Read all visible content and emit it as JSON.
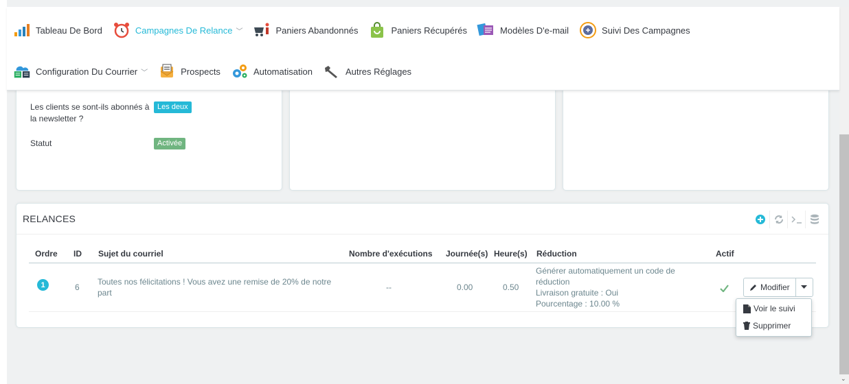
{
  "nav": {
    "row1": [
      {
        "label": "Tableau De Bord",
        "icon": "bar-chart-icon",
        "active": false,
        "chevron": false
      },
      {
        "label": "Campagnes De Relance",
        "icon": "alarm-clock-icon",
        "active": true,
        "chevron": true
      },
      {
        "label": "Paniers Abandonnés",
        "icon": "cart-person-icon",
        "active": false,
        "chevron": false
      },
      {
        "label": "Paniers Récupérés",
        "icon": "shopping-bag-icon",
        "active": false,
        "chevron": false
      },
      {
        "label": "Modèles D'e-mail",
        "icon": "email-template-icon",
        "active": false,
        "chevron": false
      },
      {
        "label": "Suivi Des Campagnes",
        "icon": "tracking-icon",
        "active": false,
        "chevron": false
      }
    ],
    "row2": [
      {
        "label": "Configuration Du Courrier",
        "icon": "mail-server-icon",
        "active": false,
        "chevron": true
      },
      {
        "label": "Prospects",
        "icon": "envelope-icon",
        "active": false,
        "chevron": false
      },
      {
        "label": "Automatisation",
        "icon": "gears-icon",
        "active": false,
        "chevron": false
      },
      {
        "label": "Autres Réglages",
        "icon": "wrench-icon",
        "active": false,
        "chevron": false
      }
    ]
  },
  "info_card": {
    "newsletter_label": "Les clients se sont-ils abonnés à la newsletter ?",
    "newsletter_value": "Les deux",
    "status_label": "Statut",
    "status_value": "Activée"
  },
  "panel": {
    "title": "RELANCES",
    "actions": [
      "add-icon",
      "refresh-icon",
      "terminal-icon",
      "database-icon"
    ]
  },
  "table": {
    "headers": {
      "order": "Ordre",
      "id": "ID",
      "subject": "Sujet du courriel",
      "executions": "Nombre d'exécutions",
      "days": "Journée(s)",
      "hours": "Heure(s)",
      "reduction": "Réduction",
      "active": "Actif"
    },
    "rows": [
      {
        "order": "1",
        "id": "6",
        "subject": "Toutes nos félicitations ! Vous avez une remise de 20% de notre part",
        "executions": "--",
        "days": "0.00",
        "hours": "0.50",
        "reduction": [
          "Générer automatiquement un code de réduction",
          "Livraison gratuite : Oui",
          "Pourcentage : 10.00 %"
        ],
        "active": true,
        "edit_label": "Modifier"
      }
    ]
  },
  "dropdown": {
    "view_label": "Voir le suivi",
    "delete_label": "Supprimer"
  },
  "colors": {
    "accent": "#25b9d7",
    "success": "#70b580",
    "text": "#363a41",
    "muted": "#6c868e"
  }
}
